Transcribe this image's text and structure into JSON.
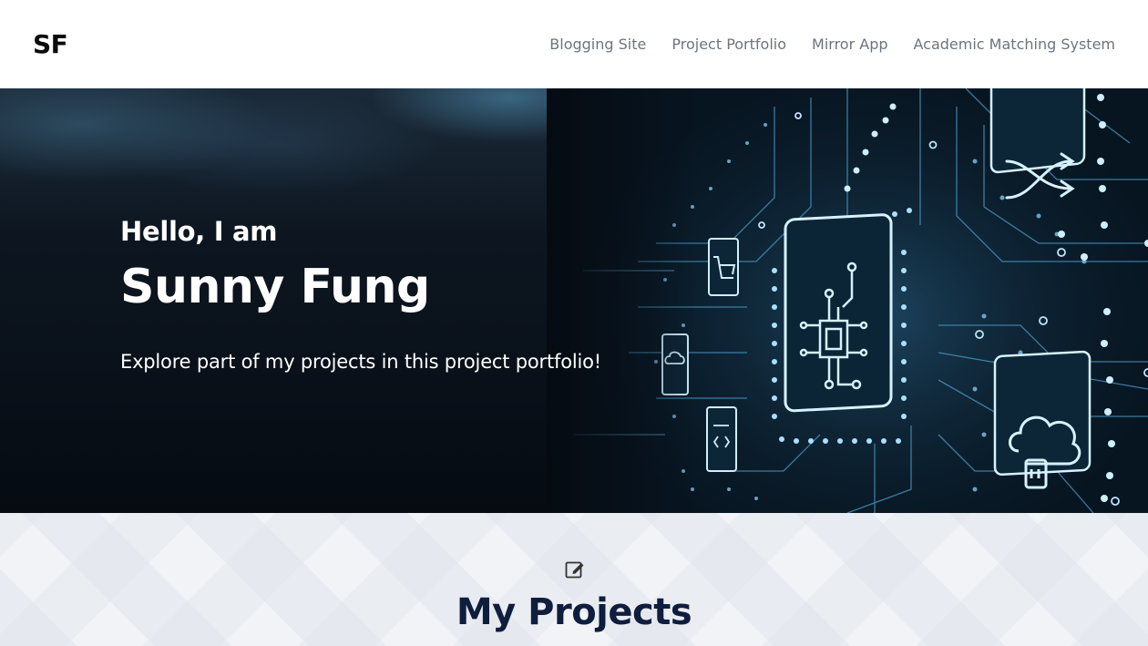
{
  "nav": {
    "logo": "SF",
    "links": [
      "Blogging Site",
      "Project Portfolio",
      "Mirror App",
      "Academic Matching System"
    ]
  },
  "hero": {
    "greeting": "Hello, I am",
    "name": "Sunny Fung",
    "subtitle": "Explore part of my projects in this project portfolio!"
  },
  "projects": {
    "icon": "edit-icon",
    "title": "My Projects"
  },
  "colors": {
    "nav_bg": "#ffffff",
    "nav_link": "#6c757d",
    "hero_dark": "#060b12",
    "circuit_glow": "#8fd3ff",
    "section_bg": "#f1f3f7",
    "title": "#0f1e3d"
  }
}
